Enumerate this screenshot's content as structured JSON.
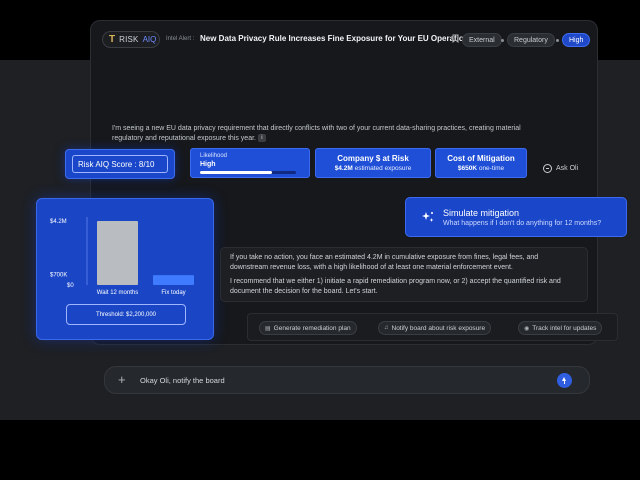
{
  "header": {
    "logo_t": "T",
    "logo_brand": "RISK",
    "logo_aiq": "AIQ",
    "alert_label": "Intel Alert :",
    "alert_title": "New Data Privacy Rule Increases Fine Exposure for Your EU Operations",
    "tags": [
      "External",
      "Regulatory",
      "High"
    ]
  },
  "lead_text": "I'm seeing a new EU data privacy requirement that directly conflicts with two of your current data-sharing practices, creating material regulatory and reputational exposure this year.",
  "score": {
    "label": "Risk AIQ Score : 8/10"
  },
  "likelihood": {
    "label": "Likelihood",
    "value": "High",
    "level_percent": 75
  },
  "company_at_risk": {
    "title": "Company $ at Risk",
    "amount": "$4.2M",
    "suffix": "estimated exposure"
  },
  "mitigation_cost": {
    "title": "Cost of Mitigation",
    "amount": "$650K",
    "suffix": "one-time"
  },
  "ask": {
    "label": "Ask Oli"
  },
  "chart_data": {
    "type": "bar",
    "categories": [
      "Wait 12 months",
      "Fix today"
    ],
    "values": [
      4200000,
      650000
    ],
    "y_tick_labels": [
      "$4.2M",
      "$700K",
      "$0"
    ],
    "y_tick_values": [
      4200000,
      700000,
      0
    ],
    "ylim": [
      0,
      4200000
    ],
    "colors": [
      "#b9bcc1",
      "#3e7bff"
    ],
    "threshold_label": "Threshold: $2,200,000"
  },
  "simulate": {
    "title": "Simulate mitigation",
    "subtitle": "What happens if I don't do anything for 12 months?"
  },
  "response": {
    "p1": "If you take no action, you face an estimated 4.2M in cumulative exposure from fines, legal fees, and downstream revenue loss, with a high likelihood of at least one material enforcement event.",
    "p2": "I recommend that we either 1) initiate a rapid remediation program now, or 2) accept the quantified risk and document the decision for the board. Let's start."
  },
  "actions": [
    "Generate remediation plan",
    "Notify board about risk exposure",
    "Track intel for updates"
  ],
  "composer": {
    "value": "Okay Oli, notify the board"
  }
}
